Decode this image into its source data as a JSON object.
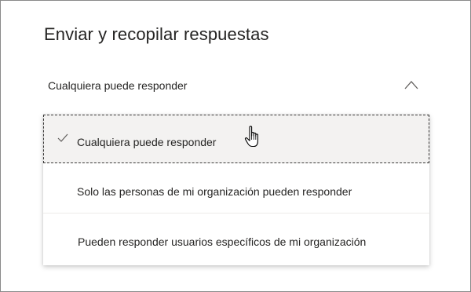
{
  "panel": {
    "title": "Enviar y recopilar respuestas"
  },
  "dropdown": {
    "selected_value": "Cualquiera puede responder",
    "expanded": true,
    "chevron_icon": "chevron-up-icon",
    "options": [
      {
        "label": "Cualquiera puede responder",
        "selected": true,
        "icon": "checkmark-icon"
      },
      {
        "label": "Solo las personas de mi organización pueden responder",
        "selected": false
      },
      {
        "label": "Pueden responder usuarios específicos de mi organización",
        "selected": false
      }
    ]
  },
  "pointer": {
    "icon": "hand-pointer-icon"
  },
  "colors": {
    "text": "#252423",
    "selected_background": "#f3f2f1",
    "focus_outline": "#3b3a39",
    "icon": "#605e5c"
  }
}
